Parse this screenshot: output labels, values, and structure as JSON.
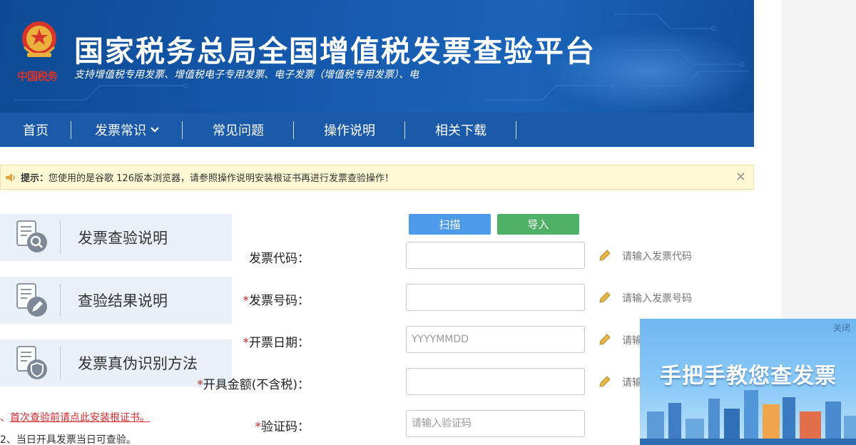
{
  "header": {
    "emblem_text": "中国税务",
    "title": "国家税务总局全国增值税发票查验平台",
    "subtitle": "支持增值税专用发票、增值税电子专用发票、电子发票（增值税专用发票）、电"
  },
  "nav": {
    "items": [
      {
        "label": "首页"
      },
      {
        "label": "发票常识"
      },
      {
        "label": "常见问题"
      },
      {
        "label": "操作说明"
      },
      {
        "label": "相关下载"
      }
    ]
  },
  "notice": {
    "prefix": "提示：",
    "text": "您使用的是谷歌 126版本浏览器，请参照操作说明安装根证书再进行发票查验操作！",
    "close": "✕"
  },
  "menu": {
    "items": [
      {
        "label": "发票查验说明",
        "icon": "document-search-icon"
      },
      {
        "label": "查验结果说明",
        "icon": "document-edit-icon"
      },
      {
        "label": "发票真伪识别方法",
        "icon": "document-shield-icon"
      }
    ]
  },
  "tips": {
    "tip1_prefix": "、",
    "tip1_link": "首次查验前请点此安装根证书。",
    "tip2": "2、当日开具发票当日可查验。"
  },
  "buttons": {
    "scan": "扫描",
    "import": "导入"
  },
  "form": {
    "fields": [
      {
        "required": "",
        "label": "发票代码：",
        "value": "",
        "placeholder": "",
        "hint": "请输入发票代码"
      },
      {
        "required": "*",
        "label": "发票号码：",
        "value": "",
        "placeholder": "",
        "hint": "请输入发票号码"
      },
      {
        "required": "*",
        "label": "开票日期：",
        "value": "",
        "placeholder": "YYYYMMDD",
        "hint": "请输"
      },
      {
        "required": "*",
        "label": "开具金额(不含税)：",
        "value": "",
        "placeholder": "",
        "hint": "请输"
      },
      {
        "required": "*",
        "label": "验证码：",
        "value": "",
        "placeholder": "请输入验证码",
        "hint": ""
      }
    ]
  },
  "ad": {
    "close": "关闭",
    "title": "手把手教您查发票"
  },
  "colors": {
    "banner": "#1559ad",
    "nav": "#1a5aa8",
    "scan_button": "#4d9ae8",
    "import_button": "#4fb068",
    "required": "#d22a2a",
    "notice_bg": "#fdf8d3"
  }
}
